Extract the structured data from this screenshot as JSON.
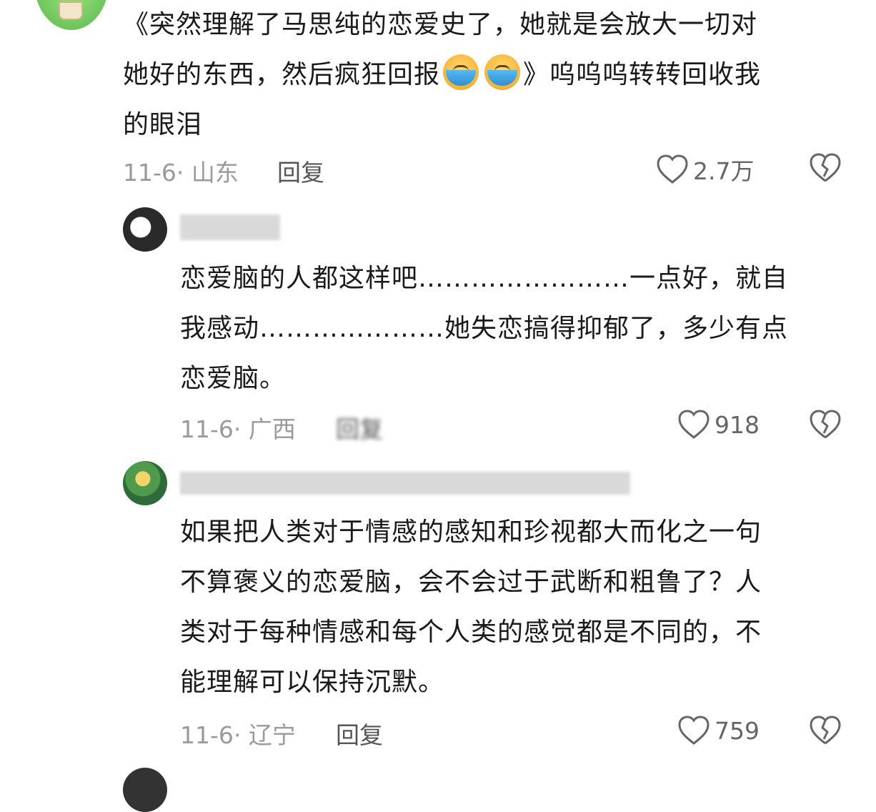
{
  "comments": [
    {
      "text_a": "《突然理解了马思纯的恋爱史了，她就是会放大一切对",
      "text_b1": "她好的东西，然后疯狂回报",
      "emoji": "loudly-crying-face-icon",
      "text_b2": "》呜呜呜转转回收我",
      "text_c": "的眼泪",
      "date_loc": "11-6· 山东",
      "reply": "回复",
      "likes": "2.7万"
    },
    {
      "username": "",
      "line1": "恋爱脑的人都这样吧……………………一点好，就自",
      "line2": "我感动…………………她失恋搞得抑郁了，多少有点",
      "line3": "恋爱脑。",
      "date_loc": "11-6· 广西",
      "reply": "回复",
      "likes": "918"
    },
    {
      "username": "",
      "line1": "如果把人类对于情感的感知和珍视都大而化之一句",
      "line2": "不算褒义的恋爱脑，会不会过于武断和粗鲁了？人",
      "line3": "类对于每种情感和每个人类的感觉都是不同的，不",
      "line4": "能理解可以保持沉默。",
      "date_loc": "11-6· 辽宁",
      "reply": "回复",
      "likes": "759"
    }
  ],
  "icons": {
    "like": "heart-outline-icon",
    "dislike": "broken-heart-icon"
  },
  "colors": {
    "meta": "#9a9a9a",
    "text": "#1a1a1a"
  }
}
